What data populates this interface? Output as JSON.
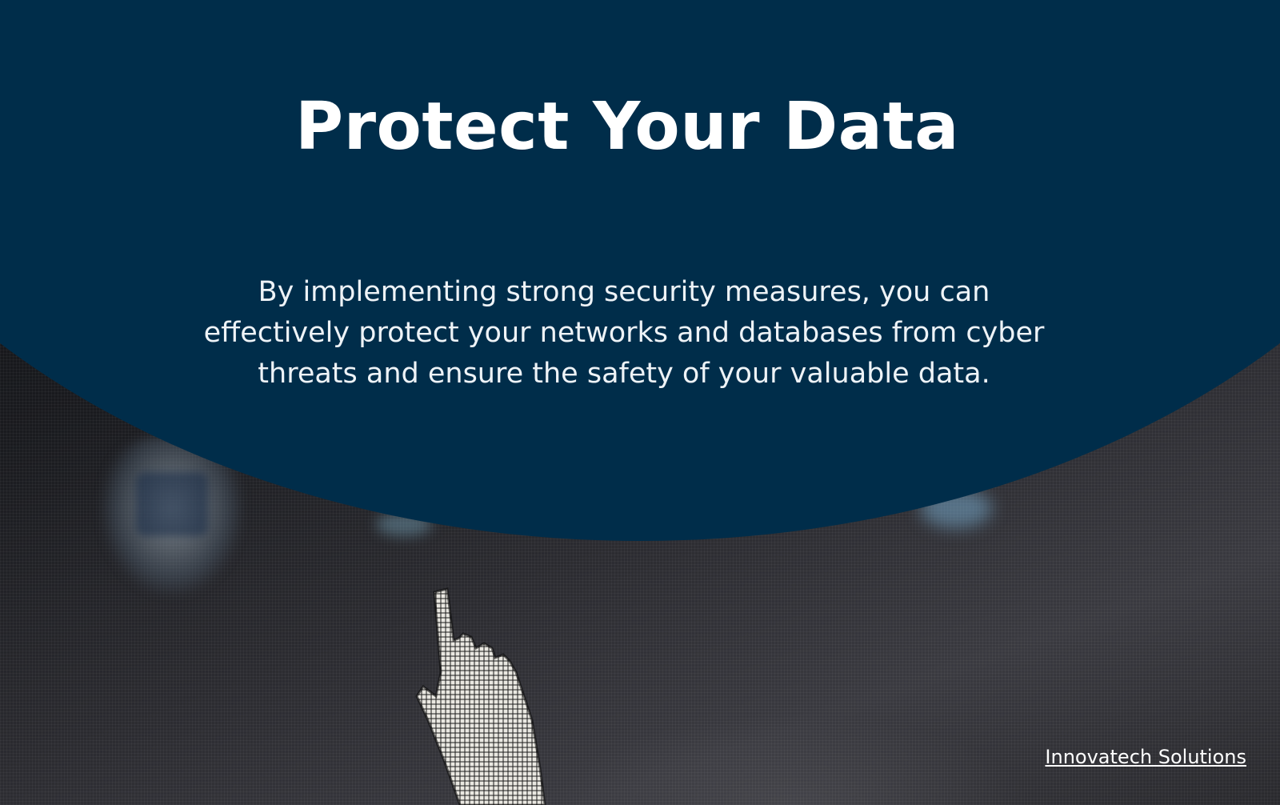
{
  "hero": {
    "title": "Protect Your Data",
    "body": "By implementing strong security measures, you can effectively protect your networks and databases from cyber threats and ensure the safety of your valuable data."
  },
  "footer": {
    "brand_link": "Innovatech Solutions"
  },
  "colors": {
    "panel_navy": "#002d4a",
    "text": "#ffffff"
  },
  "background": {
    "icons": [
      "pointer-hand-cursor-icon"
    ]
  }
}
